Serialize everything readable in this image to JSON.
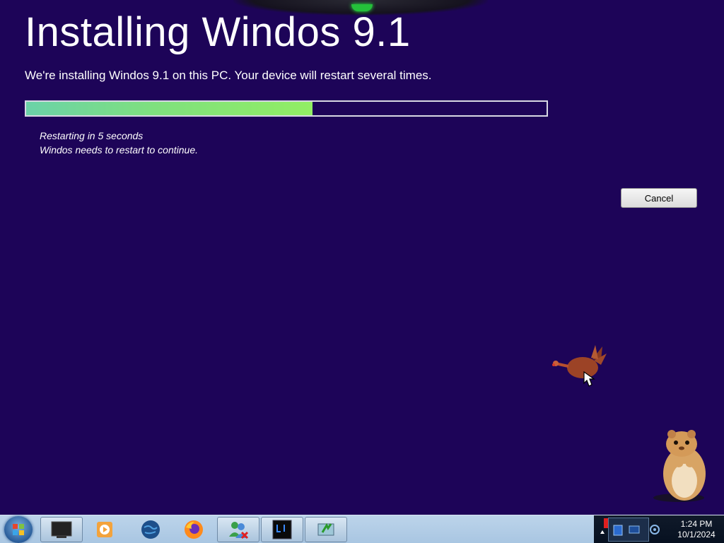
{
  "installer": {
    "title": "Installing Windos 9.1",
    "subtitle": "We're installing Windos 9.1 on this PC. Your device will restart several times.",
    "progress_fraction": 0.55,
    "status_line_1": "Restarting in 5 seconds",
    "status_line_2": "Windos needs to restart to continue.",
    "cancel_label": "Cancel"
  },
  "desktop_pets": [
    "turkey-pet",
    "hamster-pet"
  ],
  "taskbar": {
    "start_button": "windows-orb-icon",
    "items": [
      {
        "icon": "tv-app-icon",
        "active": true
      },
      {
        "icon": "media-player-icon",
        "active": false
      },
      {
        "icon": "globe-icon",
        "active": false
      },
      {
        "icon": "firefox-icon",
        "active": false
      },
      {
        "icon": "users-error-icon",
        "active": true
      },
      {
        "icon": "task-manager-icon",
        "active": true
      },
      {
        "icon": "installer-icon",
        "active": true
      }
    ],
    "tray_icons": [
      "flag-icon",
      "show-hidden-icon",
      "tray-app-icon-1",
      "tray-app-icon-2",
      "tray-app-icon-3"
    ],
    "clock_time": "1:24 PM",
    "clock_date": "10/1/2024"
  },
  "colors": {
    "background": "#1d0458",
    "progress_fill": "#7fe07e",
    "taskbar": "#a9c6e2"
  }
}
